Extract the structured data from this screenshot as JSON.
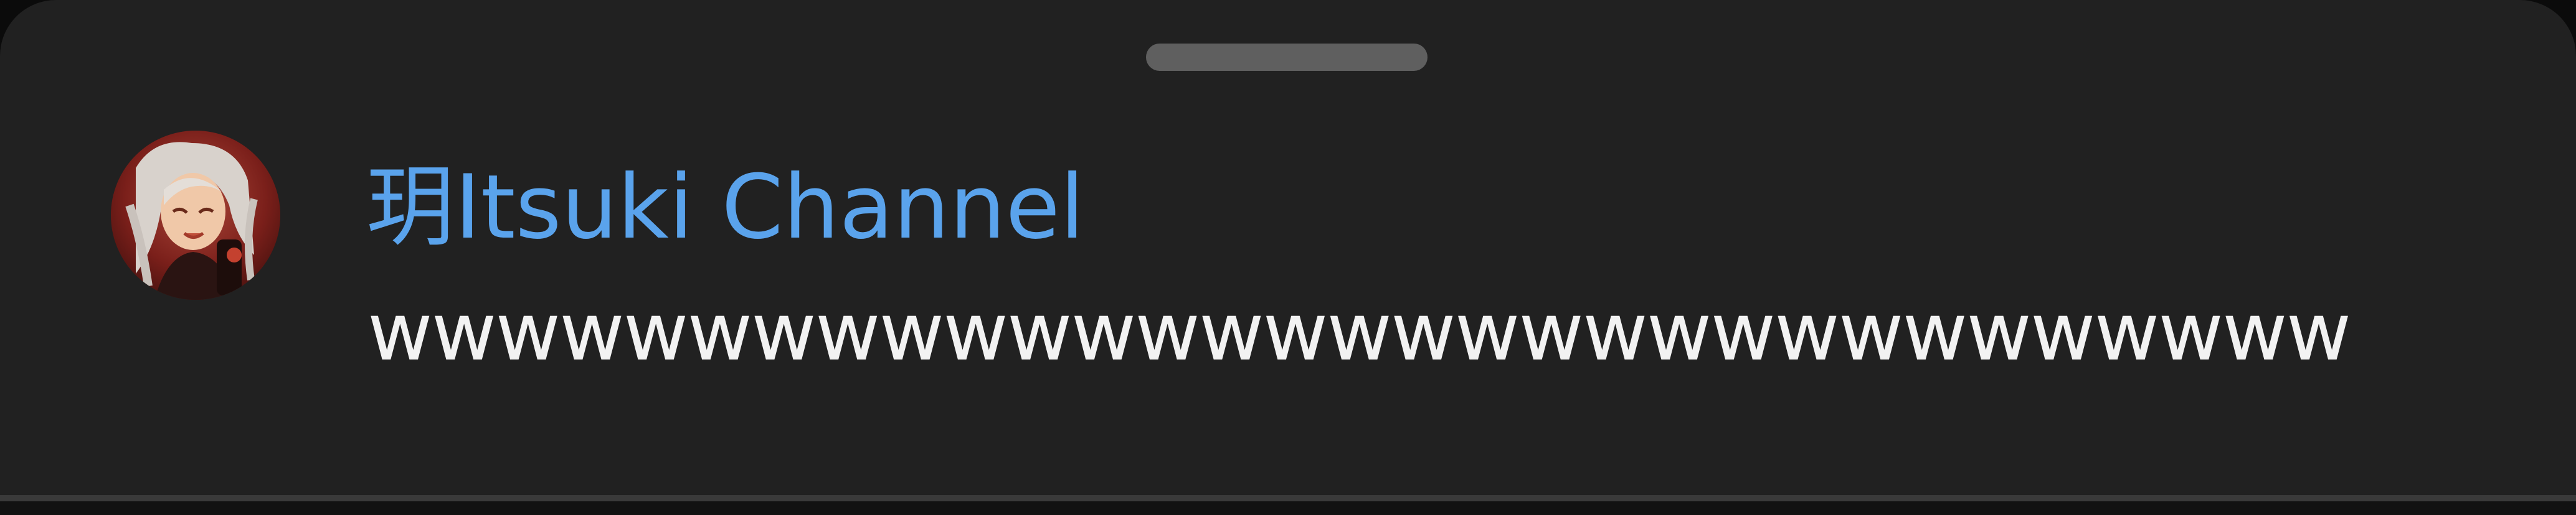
{
  "chat_message": {
    "author_name": "玥Itsuki Channel",
    "message_text": "wwwwwwwwwwwwwwwwwwwwwwwwwwwwwww",
    "avatar_icon": "anime-girl-avatar",
    "author_color": "#5aa3ec",
    "message_color": "#f2f2f2"
  },
  "sheet": {
    "background": "#212121",
    "handle_color": "#5f5f5f"
  }
}
